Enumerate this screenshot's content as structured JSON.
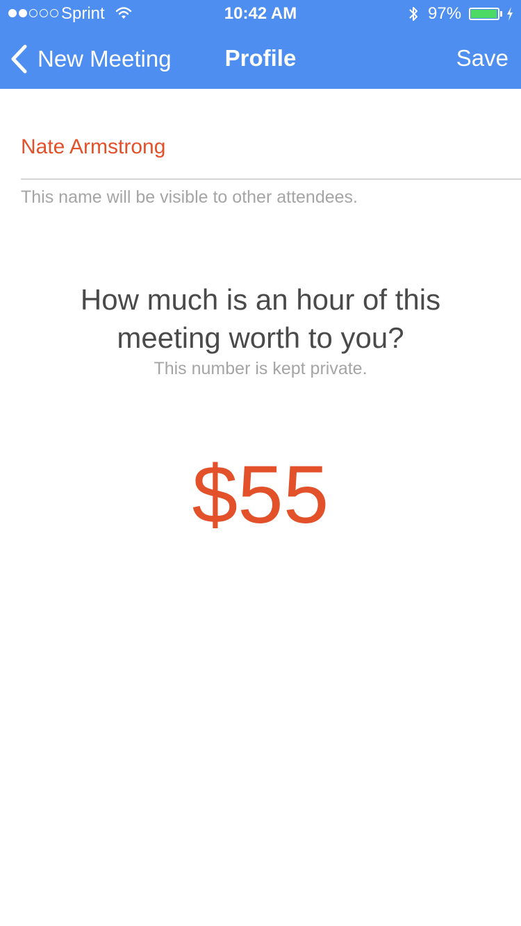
{
  "status_bar": {
    "carrier": "Sprint",
    "signal_bars_filled": 2,
    "signal_bars_total": 5,
    "wifi_icon": "wifi-icon",
    "time": "10:42 AM",
    "bluetooth_icon": "bluetooth-icon",
    "battery_percent_label": "97%",
    "battery_level": 0.97,
    "battery_color": "#4cd964",
    "charging_icon": "lightning-bolt-icon"
  },
  "nav": {
    "back_icon": "chevron-left-icon",
    "back_label": "New Meeting",
    "title": "Profile",
    "save_label": "Save",
    "bar_color": "#4d8ef0"
  },
  "profile": {
    "name_value": "Nate Armstrong",
    "name_hint": "This name will be visible to other attendees.",
    "accent_color": "#e2512a"
  },
  "value_prompt": {
    "question_line1": "How much is an hour of this",
    "question_line2": "meeting worth to you?",
    "privacy_note": "This number is kept private.",
    "amount": "$55"
  }
}
